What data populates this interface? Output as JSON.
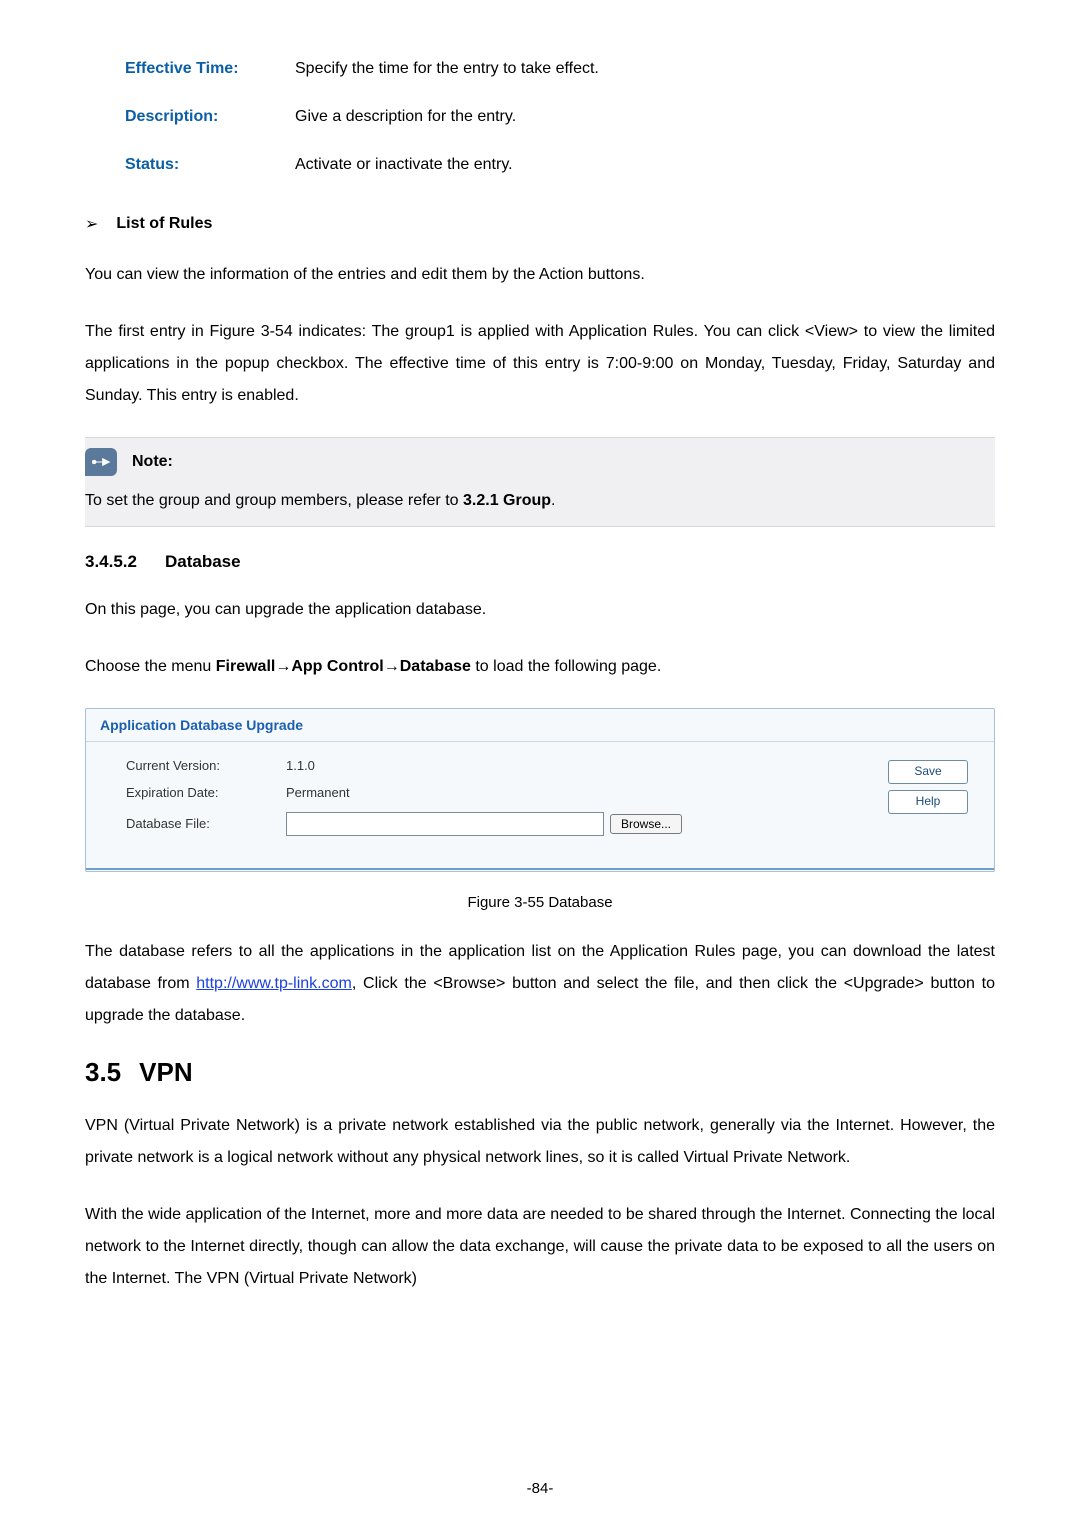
{
  "definitions": {
    "effective_time": {
      "label": "Effective Time:",
      "value": "Specify the time for the entry to take effect."
    },
    "description": {
      "label": "Description:",
      "value": "Give a description for the entry."
    },
    "status": {
      "label": "Status:",
      "value": "Activate or inactivate the entry."
    }
  },
  "list_of_rules": {
    "heading": "List of Rules",
    "p1": "You can view the information of the entries and edit them by the Action buttons.",
    "p2": "The first entry in Figure 3-54 indicates: The group1 is applied with Application Rules. You can click <View> to view the limited applications in the popup checkbox. The effective time of this entry is 7:00-9:00 on Monday, Tuesday, Friday, Saturday and Sunday. This entry is enabled."
  },
  "note": {
    "label": "Note:",
    "body_prefix": "To set the group and group members, please refer to ",
    "body_bold": "3.2.1 Group",
    "body_suffix": "."
  },
  "section_34_5_2": {
    "num": "3.4.5.2",
    "title": "Database",
    "p1": "On this page, you can upgrade the application database.",
    "p2_prefix": "Choose the menu ",
    "p2_bold": "Firewall→App Control→Database",
    "p2_suffix": " to load the following page."
  },
  "ui": {
    "panel_title": "Application Database Upgrade",
    "current_version_label": "Current Version:",
    "current_version_value": "1.1.0",
    "expiration_label": "Expiration Date:",
    "expiration_value": "Permanent",
    "file_label": "Database File:",
    "file_value": "",
    "browse_btn": "Browse...",
    "save_btn": "Save",
    "help_btn": "Help"
  },
  "figure_caption": "Figure 3-55 Database",
  "after_figure": {
    "text_before_link": "The database refers to all the applications in the application list on the Application Rules page, you can download the latest database from ",
    "link_text": "http://www.tp-link.com",
    "text_after_link": ", Click the <Browse> button and select the file, and then click the <Upgrade> button to upgrade the database."
  },
  "section_35": {
    "num": "3.5",
    "title": "VPN",
    "p1": "VPN (Virtual Private Network) is a private network established via the public network, generally via the Internet. However, the private network is a logical network without any physical network lines, so it is called Virtual Private Network.",
    "p2": "With the wide application of the Internet, more and more data are needed to be shared through the Internet. Connecting the local network to the Internet directly, though can allow the data exchange, will cause the private data to be exposed to all the users on the Internet. The VPN (Virtual Private Network)"
  },
  "page_number": "-84-"
}
